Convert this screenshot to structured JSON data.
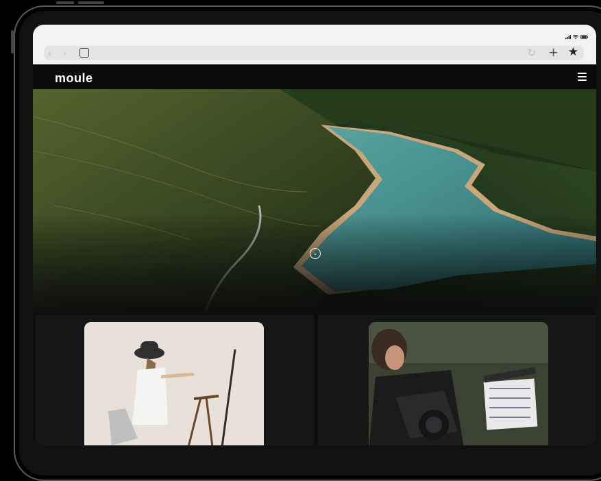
{
  "browser": {
    "back_icon": "chevron-left-icon",
    "forward_icon": "chevron-right-icon",
    "tabs_icon": "tabs-square-icon",
    "reload_icon": "reload-icon",
    "new_tab_icon": "plus-icon",
    "bookmark_icon": "star-icon",
    "status_icons": [
      "signal-icon",
      "wifi-icon",
      "battery-icon"
    ]
  },
  "site": {
    "logo_text": "moule",
    "menu_icon": "hamburger-icon",
    "hero": {
      "image": "aerial view of a turquoise reservoir winding through forested terraced hills",
      "scroll_icon": "chevron-down-circle-icon"
    },
    "cards": [
      {
        "image": "woman in bucket hat painting at an easel"
      },
      {
        "image": "woman holding film clapperboard behind camera"
      }
    ]
  },
  "colors": {
    "browser_chrome": "#f2f2f2",
    "page_background": "#0c0c0c",
    "water": "#3f8a8a"
  }
}
